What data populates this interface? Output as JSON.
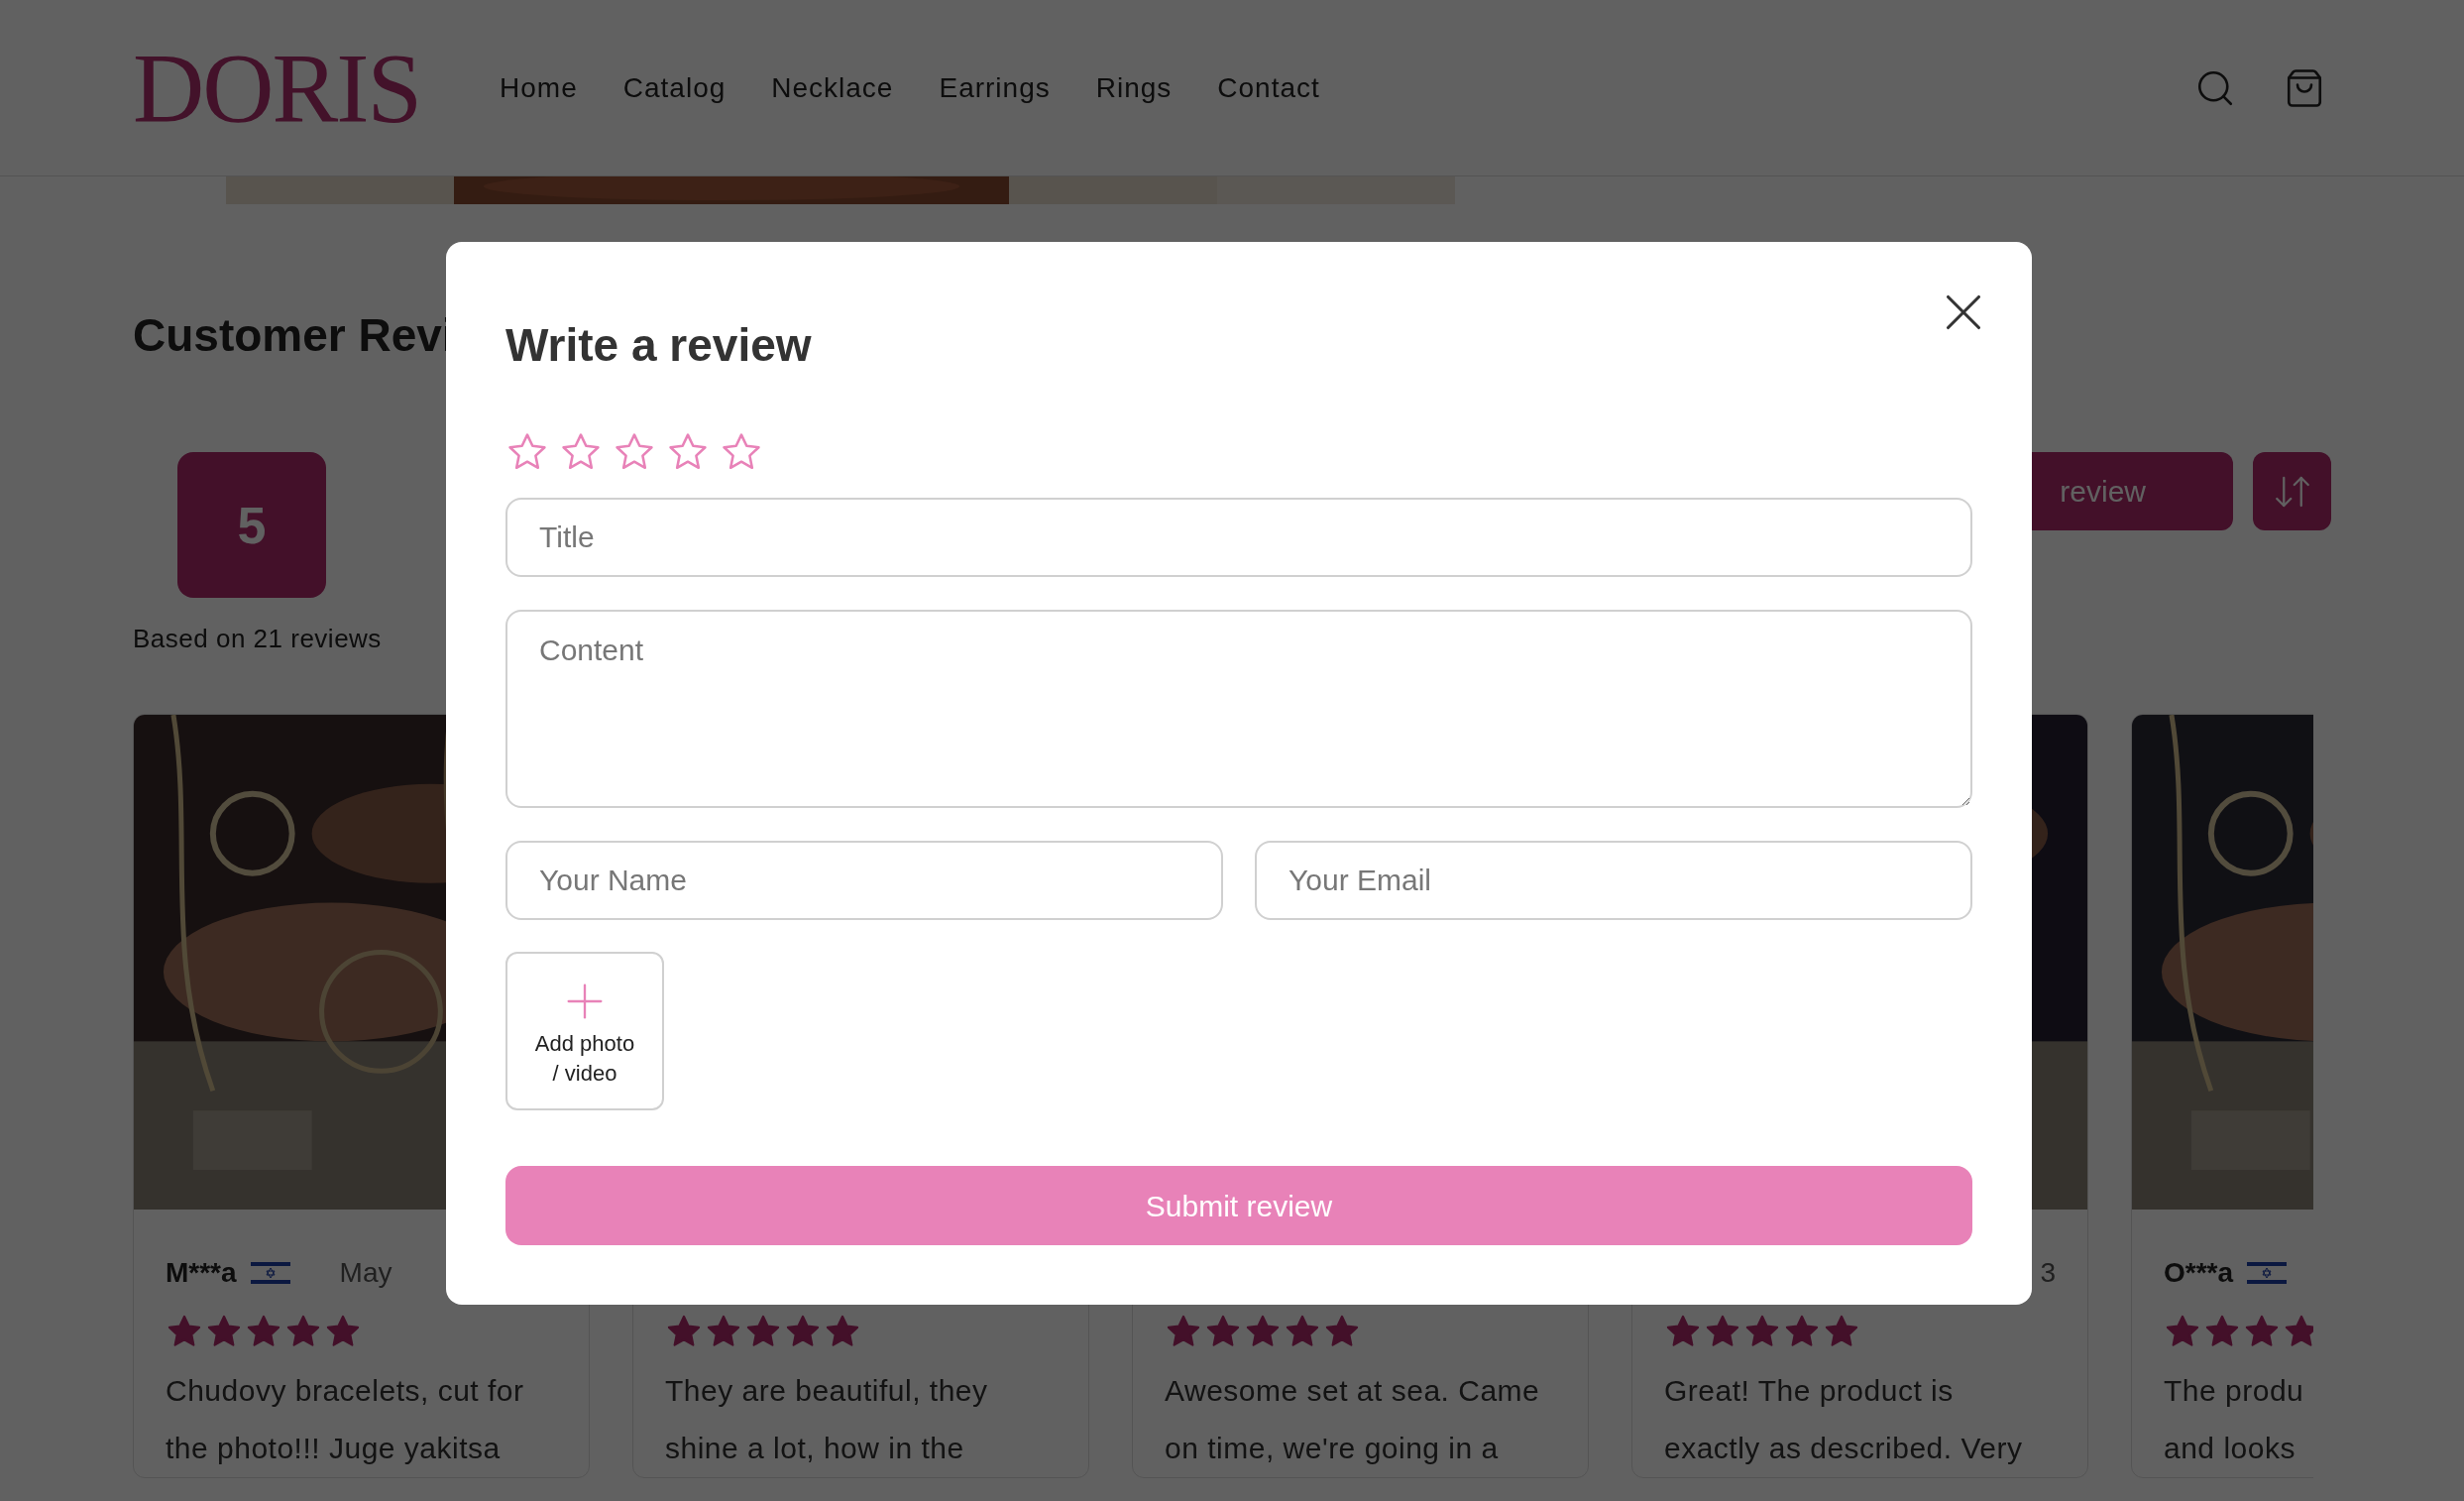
{
  "header": {
    "logo": "DORIS",
    "nav": [
      {
        "label": "Home"
      },
      {
        "label": "Catalog"
      },
      {
        "label": "Necklace"
      },
      {
        "label": "Earrings"
      },
      {
        "label": "Rings"
      },
      {
        "label": "Contact"
      }
    ]
  },
  "reviews": {
    "heading": "Customer Revi",
    "score": "5",
    "based_on": "Based on 21 reviews",
    "write_button": "review",
    "cards": [
      {
        "photo": true,
        "name": "M***a",
        "flag": true,
        "date": "May",
        "date_right": false,
        "stars": 5,
        "lines": [
          "Chudovy bracelets, cut for",
          "the photo!!! Juge yakitsa"
        ]
      },
      {
        "photo": false,
        "flag": false,
        "stars": 5,
        "lines": [
          "They are beautiful, they",
          "shine a lot, how in the"
        ]
      },
      {
        "photo": false,
        "flag": false,
        "stars": 5,
        "lines": [
          "Awesome set at sea. Came",
          "on time, we're going in a"
        ]
      },
      {
        "photo": true,
        "flag": false,
        "date": "3",
        "date_right": true,
        "stars": 5,
        "lines": [
          "Great! The product is",
          "exactly as described. Very"
        ]
      },
      {
        "photo": true,
        "name": "O***a",
        "flag": true,
        "stars": 4,
        "lines": [
          "The produ",
          "and looks"
        ]
      }
    ]
  },
  "modal": {
    "title": "Write a review",
    "rating": {
      "stars": 0
    },
    "title_field": {
      "placeholder": "Title"
    },
    "content_field": {
      "placeholder": "Content"
    },
    "name_field": {
      "placeholder": "Your Name"
    },
    "email_field": {
      "placeholder": "Your Email"
    },
    "upload": {
      "label_lines": [
        "Add photo",
        "/ video"
      ]
    },
    "submit": "Submit review"
  }
}
